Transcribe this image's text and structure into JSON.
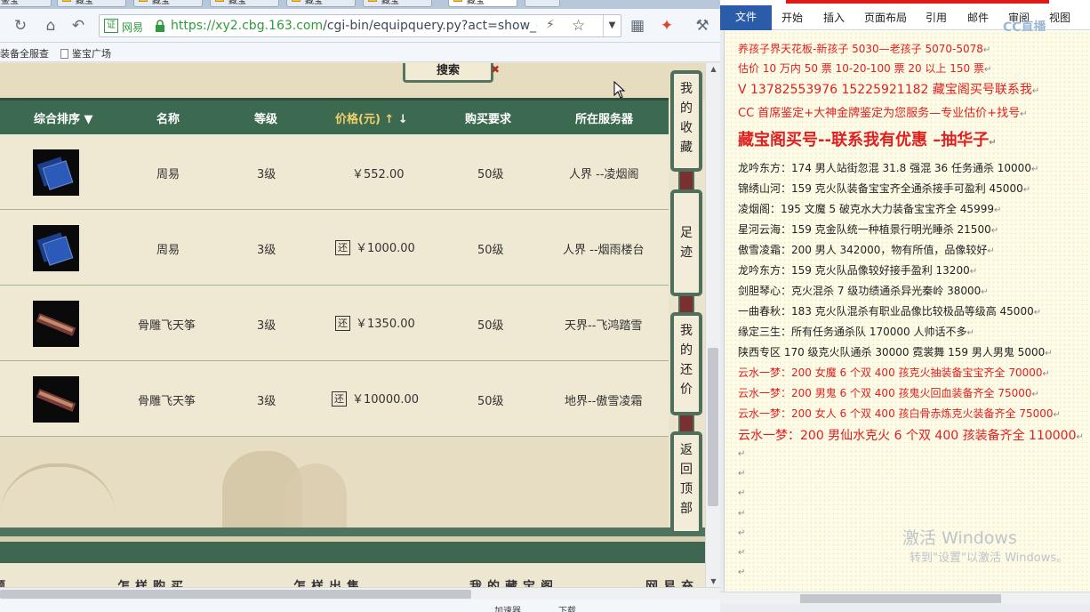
{
  "browser": {
    "tabs": [
      {
        "label": "鉴宝"
      },
      {
        "label": "藏宝"
      },
      {
        "label": "藏宝"
      },
      {
        "label": "藏宝"
      },
      {
        "label": "藏宝"
      },
      {
        "label": "藏宝"
      },
      {
        "label": "藏宝"
      }
    ],
    "url_cert": "证",
    "url_site": "网易",
    "url_host": "https://xy2.cbg.163.com",
    "url_path": "/cgi-bin/equipquery.py?act=show_ov",
    "bookmarks": [
      "装备全服查",
      "鉴宝广场"
    ],
    "status_items": [
      "加速器",
      "下载"
    ]
  },
  "page": {
    "search_label": "搜索",
    "columns": {
      "sort": "综合排序",
      "name": "名称",
      "level": "等级",
      "price": "价格(元)",
      "req": "购买要求",
      "server": "所在服务器"
    },
    "rows": [
      {
        "item": "tome",
        "name": "周易",
        "level": "3级",
        "bargain": false,
        "price": "￥552.00",
        "req": "50级",
        "server": "人界 --凌烟阁"
      },
      {
        "item": "tome",
        "name": "周易",
        "level": "3级",
        "bargain": true,
        "price": "￥1000.00",
        "req": "50级",
        "server": "人界 --烟雨楼台"
      },
      {
        "item": "zither",
        "name": "骨雕飞天筝",
        "level": "3级",
        "bargain": true,
        "price": "￥1350.00",
        "req": "50级",
        "server": "天界--飞鸿踏雪"
      },
      {
        "item": "zither",
        "name": "骨雕飞天筝",
        "level": "3级",
        "bargain": true,
        "price": "￥10000.00",
        "req": "50级",
        "server": "地界--傲雪凌霜"
      }
    ],
    "bargain_label": "还",
    "side_buttons": [
      "我的收藏",
      "足迹",
      "我的还价",
      "返回顶部"
    ],
    "footer_nav": [
      "题",
      "怎样购买",
      "怎样出售",
      "我的藏宝阁",
      "网易充"
    ]
  },
  "word": {
    "file_tab": "文件",
    "ribbon_tabs": [
      "开始",
      "插入",
      "页面布局",
      "引用",
      "邮件",
      "审阅",
      "视图"
    ],
    "cc_mark": "CC直播",
    "lines": [
      {
        "text": "养孩子界天花板-新孩子 5030—老孩子 5070-5078",
        "style": "red"
      },
      {
        "text": "估价 10 万内 50 票    10-20-100 票       20 以上 150 票",
        "style": "red"
      },
      {
        "text": "V 13782553976    15225921182  藏宝阁买号联系我",
        "style": "red big"
      },
      {
        "text": "CC 首席鉴定+大神金牌鉴定为您服务—专业估价+找号",
        "style": "red reg"
      },
      {
        "text": "藏宝阁买号--联系我有优惠 –抽华子",
        "style": "red huge"
      },
      {
        "text": "龙吟东方：174 男人站街忽混 31.8 强混 36 任务通杀 10000",
        "style": ""
      },
      {
        "text": "锦绣山河：159 克火队装备宝宝齐全通杀接手可盈利 45000",
        "style": ""
      },
      {
        "text": "凌烟阁：195 文魔 5 破克水大力装备宝宝齐全 45999",
        "style": ""
      },
      {
        "text": "星河云海：159 克金队统一种植景行明光睡杀 21500",
        "style": ""
      },
      {
        "text": "傲雪凌霜：200 男人 342000，物有所值，品像较好",
        "style": ""
      },
      {
        "text": "龙吟东方：159 克火队品像较好接手盈利 13200",
        "style": ""
      },
      {
        "text": "剑胆琴心：克火混杀 7 级功绩通杀异光秦岭 38000",
        "style": ""
      },
      {
        "text": "一曲春秋：183 克火队混杀有职业品像比较极品等级高 45000",
        "style": ""
      },
      {
        "text": "缘定三生：所有任务通杀队 170000 人帅话不多",
        "style": ""
      },
      {
        "text": "陕西专区 170 级克火队通杀 30000      霓裳舞 159 男人男鬼 5000",
        "style": ""
      },
      {
        "text": "云水一梦：200 女魔 6 个双 400 孩克火抽装备宝宝齐全 70000",
        "style": "red"
      },
      {
        "text": "云水一梦：200 男鬼 6 个双 400 孩鬼火回血装备齐全 75000",
        "style": "red"
      },
      {
        "text": "云水一梦：200 女人 6 个双 400 孩白骨赤炼克火装备齐全 75000",
        "style": "red"
      },
      {
        "text": "云水一梦：200 男仙水克火 6 个双 400 孩装备齐全 110000",
        "style": "red big"
      },
      {
        "text": "",
        "style": ""
      },
      {
        "text": "",
        "style": ""
      },
      {
        "text": "",
        "style": ""
      },
      {
        "text": "",
        "style": ""
      },
      {
        "text": "",
        "style": ""
      },
      {
        "text": "",
        "style": ""
      },
      {
        "text": "",
        "style": ""
      }
    ],
    "paragraph_mark": "↵",
    "watermark_title": "激活 Windows",
    "watermark_sub": "转到\"设置\"以激活 Windows。"
  }
}
